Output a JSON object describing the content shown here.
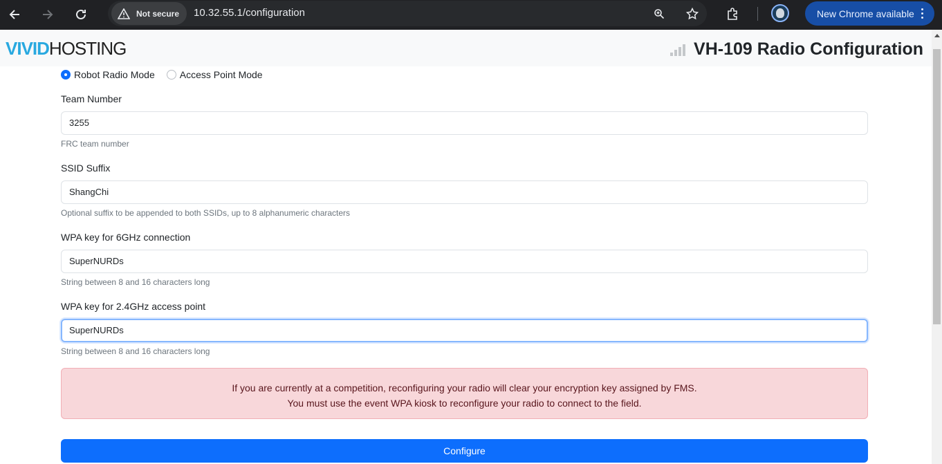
{
  "browser": {
    "security_label": "Not secure",
    "url": "10.32.55.1/configuration",
    "update_label": "New Chrome available"
  },
  "header": {
    "logo_part1": "VIVID",
    "logo_part2": "HOSTING",
    "title": "VH-109 Radio Configuration"
  },
  "form": {
    "modes": [
      {
        "label": "Robot Radio Mode",
        "checked": true
      },
      {
        "label": "Access Point Mode",
        "checked": false
      }
    ],
    "team_number": {
      "label": "Team Number",
      "value": "3255",
      "help": "FRC team number"
    },
    "ssid_suffix": {
      "label": "SSID Suffix",
      "value": "ShangChi",
      "help": "Optional suffix to be appended to both SSIDs, up to 8 alphanumeric characters"
    },
    "wpa_6ghz": {
      "label": "WPA key for 6GHz connection",
      "value": "SuperNURDs",
      "help": "String between 8 and 16 characters long"
    },
    "wpa_24ghz": {
      "label": "WPA key for 2.4GHz access point",
      "value": "SuperNURDs",
      "help": "String between 8 and 16 characters long"
    },
    "warning_line1": "If you are currently at a competition, reconfiguring your radio will clear your encryption key assigned by FMS.",
    "warning_line2": "You must use the event WPA kiosk to reconfigure your radio to connect to the field.",
    "submit_label": "Configure"
  },
  "colors": {
    "primary": "#0d6efd",
    "logo_accent": "#29a9e0",
    "alert_bg": "#f8d7da"
  }
}
